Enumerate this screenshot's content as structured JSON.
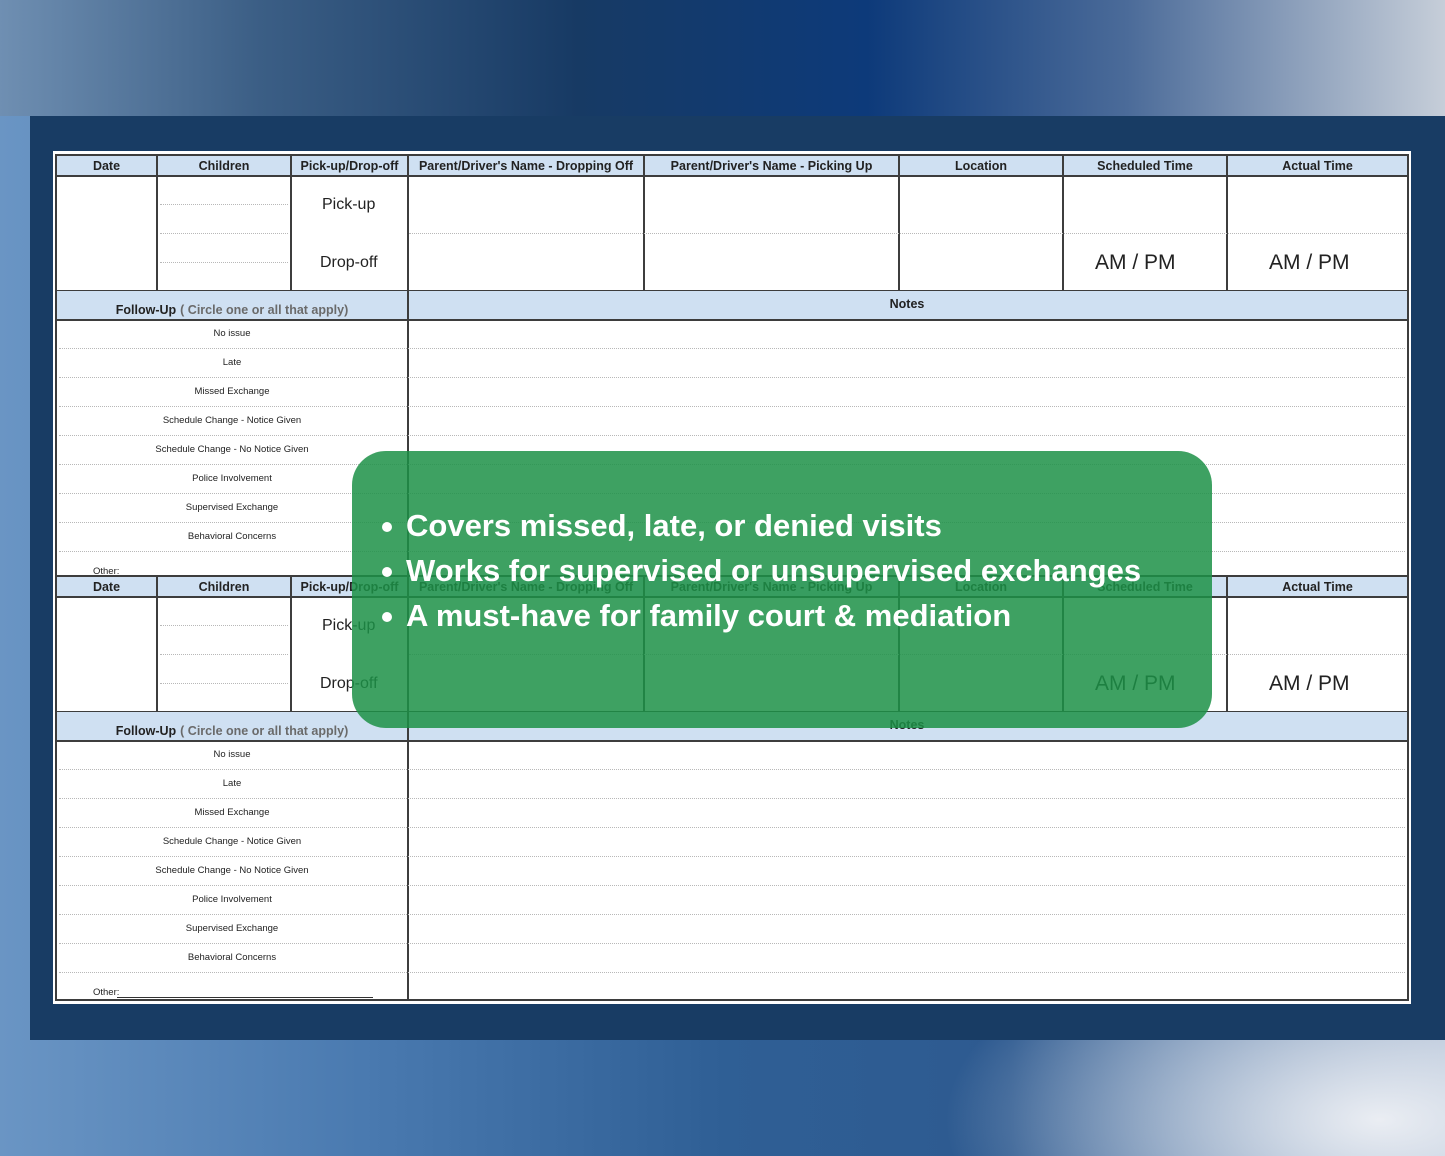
{
  "headers": [
    "Date",
    "Children",
    "Pick-up/Drop-off",
    "Parent/Driver's Name - Dropping Off",
    "Parent/Driver's Name -  Picking Up",
    "Location",
    "Scheduled Time",
    "Actual Time"
  ],
  "pickup_label": "Pick-up",
  "dropoff_label": "Drop-off",
  "scheduled_ampm": "AM  /  PM",
  "actual_ampm": "AM  /  PM",
  "followup": {
    "title": "Follow-Up",
    "subtitle": "( Circle one or all that apply)",
    "items": [
      "No issue",
      "Late",
      "Missed Exchange",
      "Schedule Change - Notice Given",
      "Schedule Change - No Notice Given",
      "Police Involvement",
      "Supervised Exchange",
      "Behavioral Concerns"
    ],
    "other_label": "Other:"
  },
  "notes_label": "Notes",
  "overlay": {
    "color": "#1c9146",
    "bullets": [
      "Covers missed, late, or denied visits",
      "Works for supervised or unsupervised exchanges",
      "A must-have for family court & mediation"
    ]
  }
}
